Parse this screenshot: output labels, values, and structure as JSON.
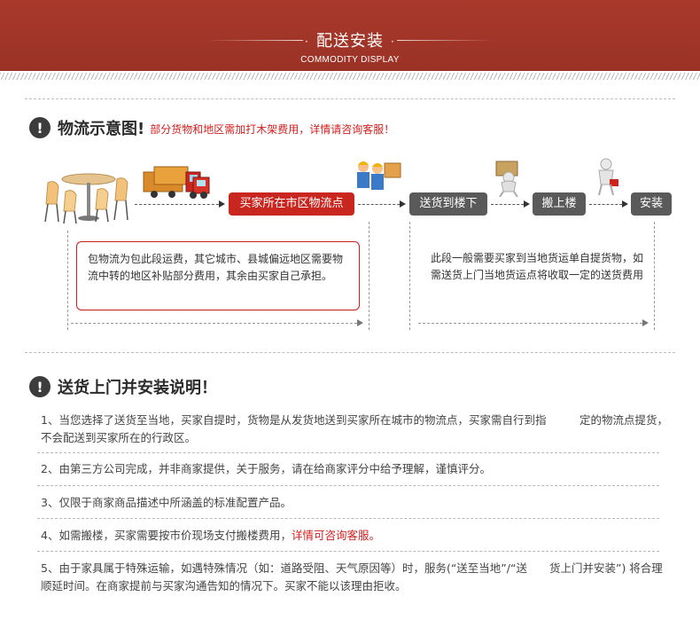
{
  "header": {
    "title": "配送安装",
    "subtitle": "COMMODITY DISPLAY",
    "dot": "·"
  },
  "section1": {
    "title": "物流示意图!",
    "note": "部分货物和地区需加打木架费用，详情请咨询客服！",
    "icon": "!"
  },
  "flow": {
    "step1": "买家所在市区物流点",
    "step2": "送货到楼下",
    "step3": "搬上楼",
    "step4": "安装"
  },
  "notes": {
    "left": "包物流为包此段运费，其它城市、县城偏远地区需要物流中转的地区补贴部分费用，其余由买家自己承担。",
    "right": "此段一般需要买家到当地货运单自提货物，如需送货上门当地货运点将收取一定的送货费用"
  },
  "section2": {
    "title": "送货上门并安装说明！",
    "icon": "!"
  },
  "items": [
    {
      "text": "1、当您选择了送货至当地，买家自提时，货物是从发货地送到买家所在城市的物流点，买家需自行到指　　　定的物流点提货，不会配送到买家所在的行政区。"
    },
    {
      "text": "2、由第三方公司完成，并非商家提供，关于服务，请在给商家评分中给予理解，谨慎评分。"
    },
    {
      "text": "3、仅限于商家商品描述中所涵盖的标准配置产品。"
    },
    {
      "text": "4、如需搬楼，买家需要按市价现场支付搬楼费用，",
      "highlight": "详情可咨询客服。"
    },
    {
      "text": "5、由于家具属于特殊运输，如遇特殊情况（如：道路受阻、天气原因等）时，服务(“送至当地”/“送　　货上门并安装”) 将合理顺延时间。在商家提前与买家沟通告知的情况下。买家不能以该理由拒收。"
    }
  ],
  "colors": {
    "header_bg": "#a8392b",
    "accent_red": "#c8261f",
    "box_dark": "#5a5a5a"
  }
}
